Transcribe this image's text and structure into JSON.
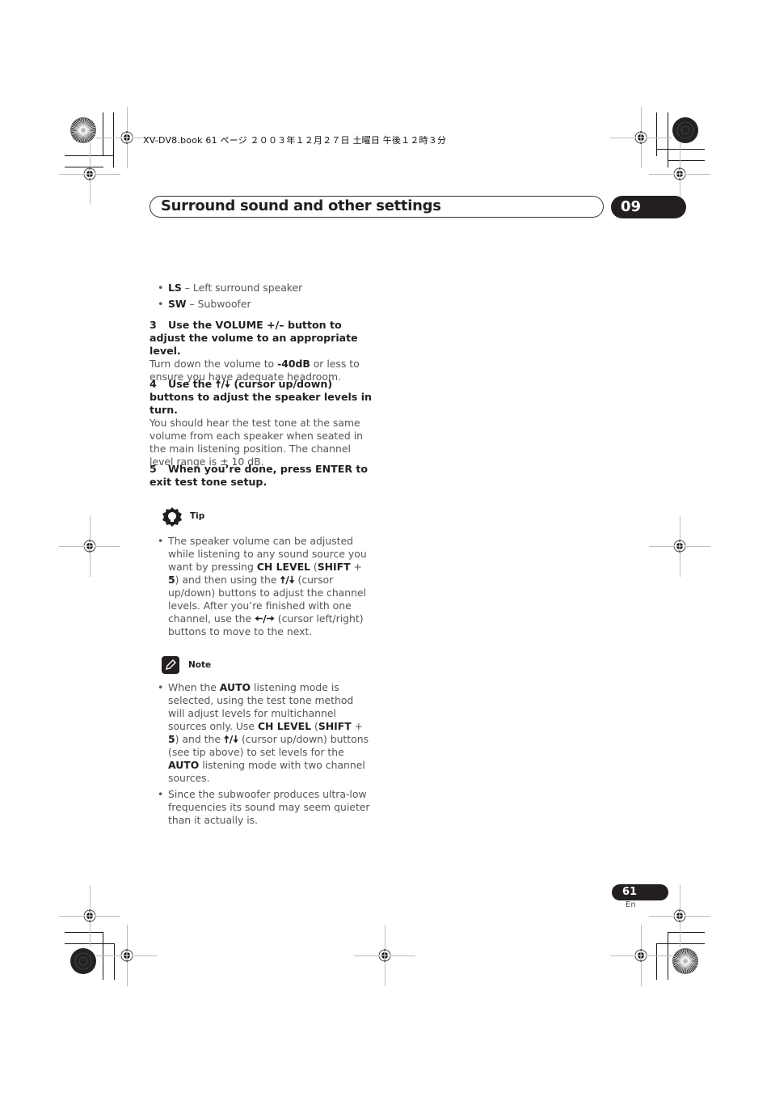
{
  "print_header": {
    "text": "XV-DV8.book 61 ページ ２００３年１２月２７日 土曜日 午後１２時３分"
  },
  "header": {
    "title": "Surround sound and other settings",
    "chapter": "09"
  },
  "speaker_list": [
    {
      "code": "LS",
      "desc": " – Left surround speaker"
    },
    {
      "code": "SW",
      "desc": " – Subwoofer"
    }
  ],
  "steps": [
    {
      "num": "3",
      "heading": "Use the VOLUME +/– button to adjust the volume to an appropriate level.",
      "body_pre": "Turn down the volume to ",
      "body_bold": "-40dB",
      "body_post": " or less to ensure you have adequate headroom."
    },
    {
      "num": "4",
      "heading_pre": "Use the ",
      "heading_arrows": "🠅/🠇",
      "heading_post": " (cursor up/down) buttons to adjust the speaker levels in turn.",
      "body": "You should hear the test tone at the same volume from each speaker when seated in the main listening position. The channel level range is ± 10 dB."
    },
    {
      "num": "5",
      "heading": "When you’re done, press ENTER to exit test tone setup."
    }
  ],
  "tip": {
    "label": "Tip",
    "icon": "lightbulb-icon",
    "items": [
      {
        "t1": "The speaker volume can be adjusted while listening to any sound source you want by pressing ",
        "b1": "CH LEVEL",
        "t2": " (",
        "b2": "SHIFT",
        "t3": " + ",
        "b3": "5",
        "t4": ") and then using the ",
        "arrows1": "🠅/🠇",
        "t5": " (cursor up/down) buttons to adjust the channel levels. After you’re finished with one channel, use the ",
        "arrows2": "🠄/🠆",
        "t6": " (cursor left/right) buttons to move to the next."
      }
    ]
  },
  "note": {
    "label": "Note",
    "icon": "pencil-icon",
    "items": [
      {
        "t1": "When the ",
        "b1": "AUTO",
        "t2": " listening mode is selected, using the test tone method will adjust levels for multichannel sources only. Use ",
        "b2": "CH LEVEL",
        "t3": " (",
        "b3": "SHIFT",
        "t4": " + ",
        "b4": "5",
        "t5": ") and the ",
        "arrows": "🠅/🠇",
        "t6": " (cursor up/down) buttons (see tip above) to set levels for the ",
        "b5": "AUTO",
        "t7": " listening mode with two channel sources."
      },
      {
        "text": "Since the subwoofer produces ultra-low frequencies its sound may seem quieter than it actually is."
      }
    ]
  },
  "footer": {
    "page_number": "61",
    "language": "En"
  }
}
